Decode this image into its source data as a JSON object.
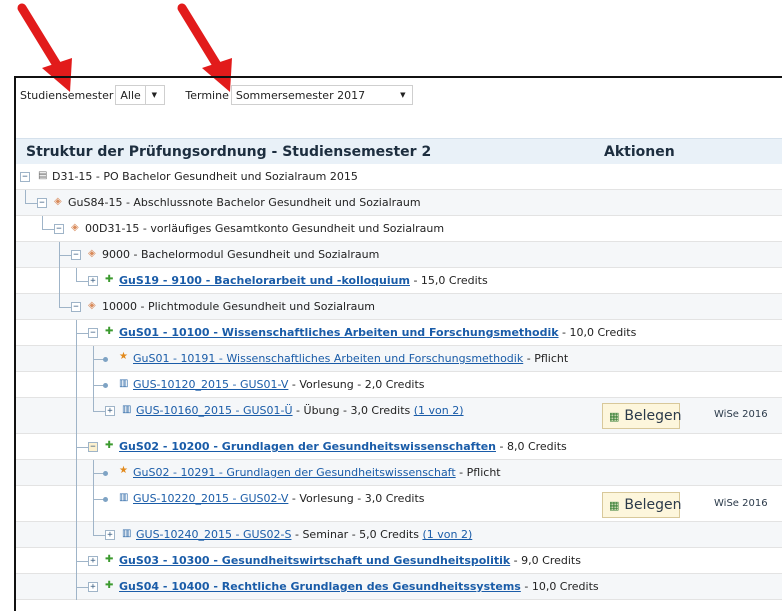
{
  "filters": {
    "semester_label": "Studiensemester",
    "semester_value": "Alle",
    "termine_label": "Termine",
    "termine_value": "Sommersemester 2017"
  },
  "table": {
    "title": "Struktur der Prüfungsordnung - Studiensemester 2",
    "actions_header": "Aktionen"
  },
  "rows": [
    {
      "link": "",
      "rest": "D31-15 - PO Bachelor Gesundheit und Sozialraum 2015",
      "icon": "document-icon"
    },
    {
      "link": "",
      "rest": "GuS84-15 - Abschlussnote Bachelor Gesundheit und Sozialraum",
      "icon": "tag-icon"
    },
    {
      "link": "",
      "rest": "00D31-15 - vorläufiges Gesamtkonto Gesundheit und Sozialraum",
      "icon": "tag-icon"
    },
    {
      "link": "",
      "rest": "9000 - Bachelormodul Gesundheit und Sozialraum",
      "icon": "tag-icon"
    },
    {
      "link": "GuS19 - 9100 - Bachelorarbeit und -kolloquium",
      "rest": " - 15,0 Credits",
      "icon": "puzzle-icon"
    },
    {
      "link": "",
      "rest": "10000 - Plichtmodule Gesundheit und Sozialraum",
      "icon": "tag-icon"
    },
    {
      "link": "GuS01 - 10100 - Wissenschaftliches Arbeiten und Forschungsmethodik",
      "rest": " - 10,0 Credits",
      "icon": "puzzle-icon"
    },
    {
      "link": "GuS01 - 10191 - Wissenschaftliches Arbeiten und Forschungsmethodik",
      "rest": " - Pflicht",
      "icon": "star-icon"
    },
    {
      "link": "GUS-10120_2015 - GUS01-V",
      "rest": " - Vorlesung - 2,0 Credits",
      "icon": "book-icon"
    },
    {
      "link": "GUS-10160_2015 - GUS01-Ü",
      "rest": " - Übung - 3,0 Credits ",
      "extra": "(1 von 2)",
      "icon": "book-icon",
      "action": "Belegen",
      "semester": "WiSe 2016"
    },
    {
      "link": "GuS02 - 10200 - Grundlagen der Gesundheitswissenschaften",
      "rest": " - 8,0 Credits",
      "icon": "puzzle-icon"
    },
    {
      "link": "GuS02 - 10291 - Grundlagen der Gesundheitswissenschaft",
      "rest": " - Pflicht",
      "icon": "star-icon"
    },
    {
      "link": "GUS-10220_2015 - GUS02-V",
      "rest": " - Vorlesung - 3,0 Credits",
      "icon": "book-icon",
      "action": "Belegen",
      "semester": "WiSe 2016"
    },
    {
      "link": "GUS-10240_2015 - GUS02-S",
      "rest": " - Seminar - 5,0 Credits ",
      "extra": "(1 von 2)",
      "icon": "book-icon"
    },
    {
      "link": "GuS03 - 10300 - Gesundheitswirtschaft und Gesundheitspolitik",
      "rest": " - 9,0 Credits",
      "icon": "puzzle-icon"
    },
    {
      "link": "GuS04 - 10400 - Rechtliche Grundlagen des Gesundheitssystems",
      "rest": " - 10,0 Credits",
      "icon": "puzzle-icon"
    }
  ],
  "colors": {
    "arrow": "#e21b1b",
    "link": "#1a5ca8",
    "header_bg": "#e9f1f8",
    "button_bg": "#fdf6dc"
  }
}
